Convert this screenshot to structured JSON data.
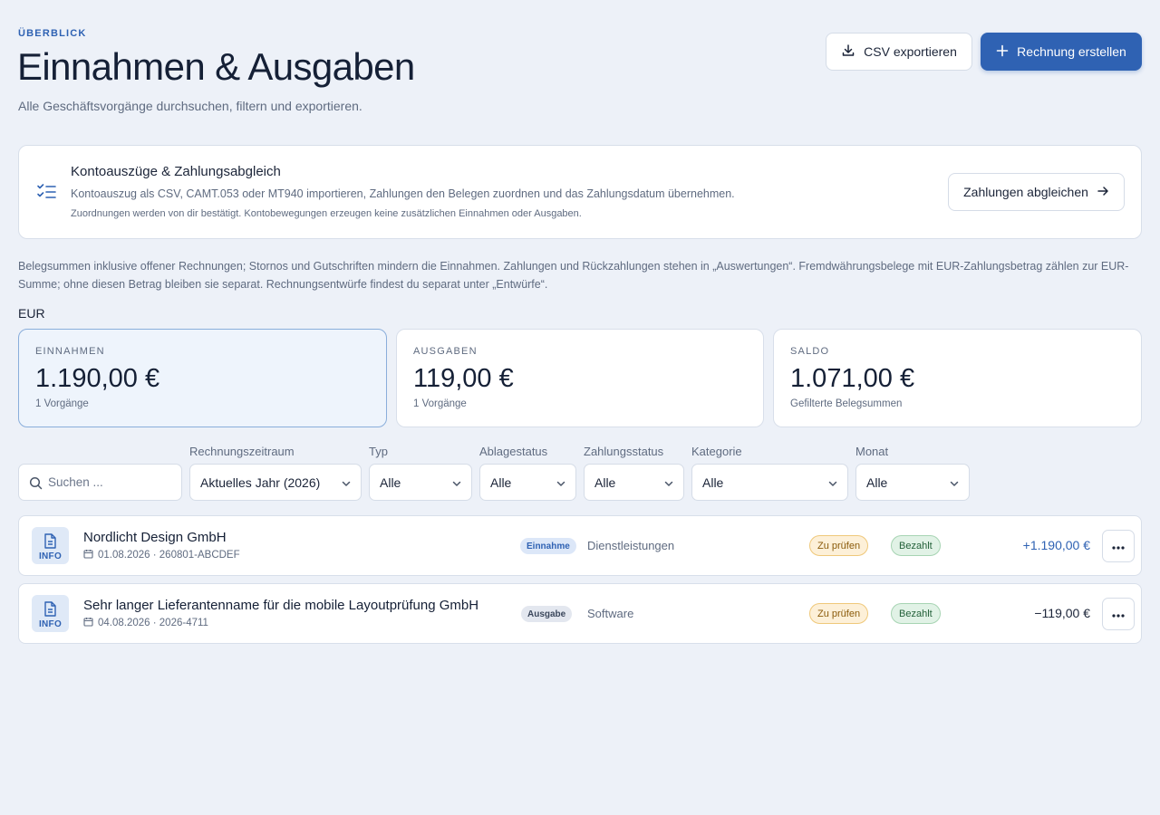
{
  "header": {
    "eyebrow": "ÜBERBLICK",
    "title": "Einnahmen & Ausgaben",
    "subtitle": "Alle Geschäftsvorgänge durchsuchen, filtern und exportieren.",
    "csv_label": "CSV exportieren",
    "new_label": "Rechnung erstellen"
  },
  "banner": {
    "title": "Kontoauszüge & Zahlungsabgleich",
    "description": "Kontoauszug als CSV, CAMT.053 oder MT940 importieren, Zahlungen den Belegen zuordnen und das Zahlungsdatum übernehmen.",
    "note": "Zuordnungen werden von dir bestätigt. Kontobewegungen erzeugen keine zusätzlichen Einnahmen oder Ausgaben.",
    "button_label": "Zahlungen abgleichen"
  },
  "info_text": "Belegsummen inklusive offener Rechnungen; Stornos und Gutschriften mindern die Einnahmen. Zahlungen und Rückzahlungen stehen in „Auswertungen“. Fremdwährungsbelege mit EUR-Zahlungsbetrag zählen zur EUR-Summe; ohne diesen Betrag bleiben sie separat. Rechnungsentwürfe findest du separat unter „Entwürfe“.",
  "currency": "EUR",
  "stats": [
    {
      "label": "EINNAHMEN",
      "value": "1.190,00 €",
      "sub": "1 Vorgänge"
    },
    {
      "label": "AUSGABEN",
      "value": "119,00 €",
      "sub": "1 Vorgänge"
    },
    {
      "label": "SALDO",
      "value": "1.071,00 €",
      "sub": "Gefilterte Belegsummen"
    }
  ],
  "filters": {
    "search_placeholder": "Suchen ...",
    "period": {
      "label": "Rechnungszeitraum",
      "value": "Aktuelles Jahr (2026)"
    },
    "type": {
      "label": "Typ",
      "value": "Alle"
    },
    "filing": {
      "label": "Ablagestatus",
      "value": "Alle"
    },
    "payment": {
      "label": "Zahlungsstatus",
      "value": "Alle"
    },
    "category": {
      "label": "Kategorie",
      "value": "Alle"
    },
    "month": {
      "label": "Monat",
      "value": "Alle"
    }
  },
  "rows": [
    {
      "icon_label": "INFO",
      "name": "Nordlicht Design GmbH",
      "meta": "01.08.2026 · 260801-ABCDEF",
      "type": "Einnahme",
      "category": "Dienstleistungen",
      "review": "Zu prüfen",
      "status": "Bezahlt",
      "amount": "+1.190,00 €"
    },
    {
      "icon_label": "INFO",
      "name": "Sehr langer Lieferantenname für die mobile Layoutprüfung GmbH",
      "meta": "04.08.2026 · 2026-4711",
      "type": "Ausgabe",
      "category": "Software",
      "review": "Zu prüfen",
      "status": "Bezahlt",
      "amount": "−119,00 €"
    }
  ],
  "colors": {
    "accent": "#2f62b3",
    "background": "#edf1f8",
    "review_bg": "#fdf0d8",
    "paid_bg": "#e1f2e6"
  }
}
